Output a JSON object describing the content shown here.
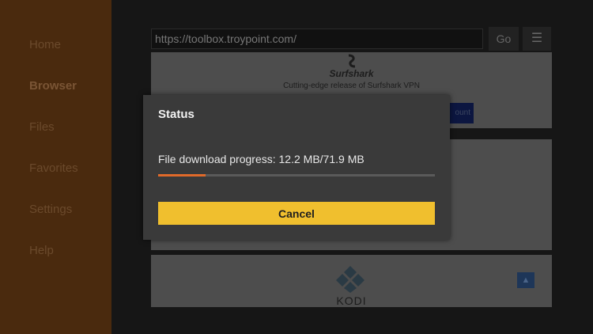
{
  "sidebar": {
    "items": [
      {
        "label": "Home",
        "active": false
      },
      {
        "label": "Browser",
        "active": true
      },
      {
        "label": "Files",
        "active": false
      },
      {
        "label": "Favorites",
        "active": false
      },
      {
        "label": "Settings",
        "active": false
      },
      {
        "label": "Help",
        "active": false
      }
    ]
  },
  "browser": {
    "url": "https://toolbox.troypoint.com/",
    "go_label": "Go",
    "menu_icon": "☰"
  },
  "page": {
    "surfshark_brand": "Surfshark",
    "surfshark_tagline": "Cutting-edge release of Surfshark VPN",
    "cta_label_partial": "ount",
    "kodi_label": "KODI",
    "scroll_top_icon": "▲"
  },
  "dialog": {
    "title": "Status",
    "message": "File download progress: 12.2 MB/71.9 MB",
    "progress_fraction": 0.17,
    "cancel_label": "Cancel"
  },
  "colors": {
    "sidebar_bg": "#4a2a0e",
    "dialog_bg": "#3a3a3a",
    "progress_fill": "#e06a2a",
    "cancel_button": "#f0bf2e"
  }
}
